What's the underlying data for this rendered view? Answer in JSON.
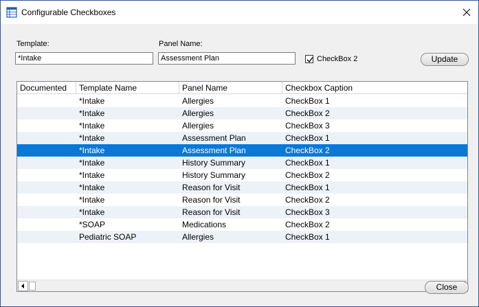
{
  "window": {
    "title": "Configurable Checkboxes"
  },
  "form": {
    "template_label": "Template:",
    "template_value": "*Intake",
    "panel_label": "Panel Name:",
    "panel_value": "Assessment Plan",
    "checkbox_label": "CheckBox 2",
    "checkbox_checked": true,
    "update_label": "Update"
  },
  "grid": {
    "columns": [
      "Documented",
      "Template Name",
      "Panel Name",
      "Checkbox Caption"
    ],
    "selected_index": 4,
    "rows": [
      [
        "",
        "*Intake",
        "Allergies",
        "CheckBox 1"
      ],
      [
        "",
        "*Intake",
        "Allergies",
        "CheckBox 2"
      ],
      [
        "",
        "*Intake",
        "Allergies",
        "CheckBox 3"
      ],
      [
        "",
        "*Intake",
        "Assessment Plan",
        "CheckBox 1"
      ],
      [
        "",
        "*Intake",
        "Assessment Plan",
        "CheckBox 2"
      ],
      [
        "",
        "*Intake",
        "History Summary",
        "CheckBox 1"
      ],
      [
        "",
        "*Intake",
        "History Summary",
        "CheckBox 2"
      ],
      [
        "",
        "*Intake",
        "Reason for Visit",
        "CheckBox 1"
      ],
      [
        "",
        "*Intake",
        "Reason for Visit",
        "CheckBox 2"
      ],
      [
        "",
        "*Intake",
        "Reason for Visit",
        "CheckBox 3"
      ],
      [
        "",
        "*SOAP",
        "Medications",
        "CheckBox 2"
      ],
      [
        "",
        "Pediatric SOAP",
        "Allergies",
        "CheckBox 1"
      ]
    ]
  },
  "footer": {
    "close_label": "Close"
  },
  "colors": {
    "selection": "#0a78d7",
    "alt_row": "#edf2f9"
  }
}
